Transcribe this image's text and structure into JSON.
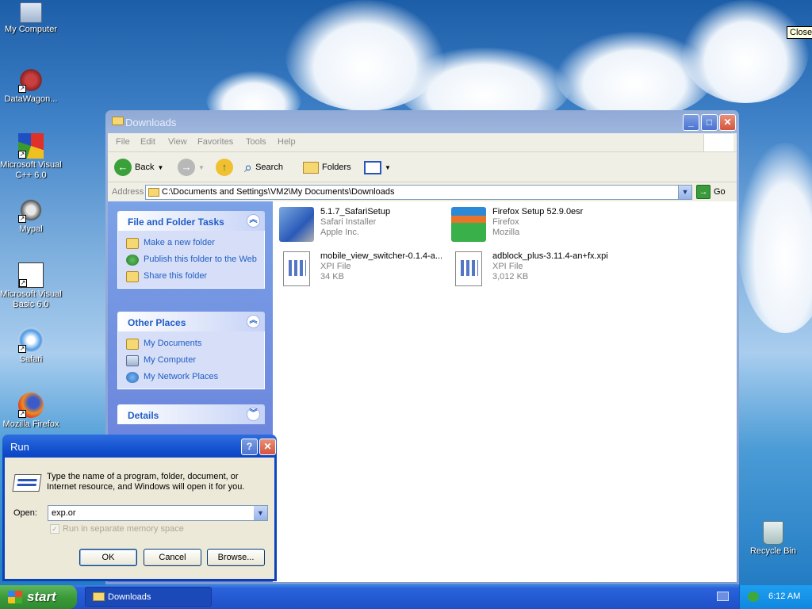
{
  "desktop": {
    "icons": [
      {
        "label": "My Computer"
      },
      {
        "label": "DataWagon..."
      },
      {
        "label": "Microsoft Visual C++ 6.0"
      },
      {
        "label": "Mypal"
      },
      {
        "label": "Microsoft Visual Basic 6.0"
      },
      {
        "label": "Safari"
      },
      {
        "label": "Mozilla Firefox"
      },
      {
        "label": "Recycle Bin"
      }
    ],
    "tooltip": "Close"
  },
  "explorer": {
    "title": "Downloads",
    "menu": [
      "File",
      "Edit",
      "View",
      "Favorites",
      "Tools",
      "Help"
    ],
    "toolbar": {
      "back": "Back",
      "search": "Search",
      "folders": "Folders"
    },
    "address": {
      "label": "Address",
      "value": "C:\\Documents and Settings\\VM2\\My Documents\\Downloads",
      "go": "Go"
    },
    "tasks": {
      "file_folder": {
        "title": "File and Folder Tasks",
        "items": [
          "Make a new folder",
          "Publish this folder to the Web",
          "Share this folder"
        ]
      },
      "other_places": {
        "title": "Other Places",
        "items": [
          "My Documents",
          "My Computer",
          "My Network Places"
        ]
      },
      "details": {
        "title": "Details"
      }
    },
    "files": [
      {
        "name": "5.1.7_SafariSetup",
        "line2": "Safari Installer",
        "line3": "Apple Inc."
      },
      {
        "name": "Firefox Setup 52.9.0esr",
        "line2": "Firefox",
        "line3": "Mozilla"
      },
      {
        "name": "mobile_view_switcher-0.1.4-a...",
        "line2": "XPI File",
        "line3": "34 KB"
      },
      {
        "name": "adblock_plus-3.11.4-an+fx.xpi",
        "line2": "XPI File",
        "line3": "3,012 KB"
      }
    ]
  },
  "run": {
    "title": "Run",
    "description": "Type the name of a program, folder, document, or Internet resource, and Windows will open it for you.",
    "open_label": "Open:",
    "open_value": "exp.or",
    "checkbox": "Run in separate memory space",
    "ok": "OK",
    "cancel": "Cancel",
    "browse": "Browse..."
  },
  "taskbar": {
    "start": "start",
    "task": "Downloads",
    "time": "6:12 AM"
  }
}
